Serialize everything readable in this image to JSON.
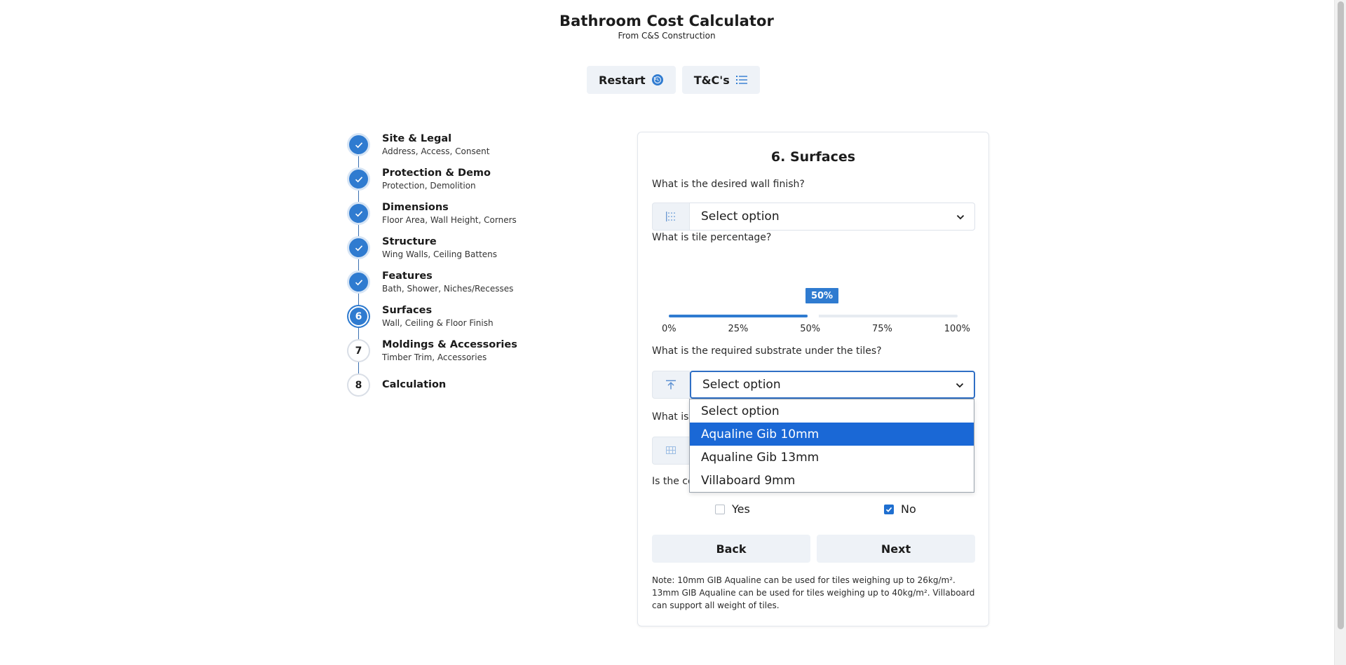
{
  "header": {
    "title": "Bathroom Cost Calculator",
    "subtitle": "From C&S Construction"
  },
  "actions": {
    "restart_label": "Restart",
    "restart_icon": "restart-icon",
    "tcs_label": "T&C's",
    "tcs_icon": "list-icon"
  },
  "steps": [
    {
      "number": "1",
      "name": "Site & Legal",
      "desc": "Address, Access, Consent",
      "status": "done"
    },
    {
      "number": "2",
      "name": "Protection & Demo",
      "desc": "Protection, Demolition",
      "status": "done"
    },
    {
      "number": "3",
      "name": "Dimensions",
      "desc": "Floor Area, Wall Height, Corners",
      "status": "done"
    },
    {
      "number": "4",
      "name": "Structure",
      "desc": "Wing Walls, Ceiling Battens",
      "status": "done"
    },
    {
      "number": "5",
      "name": "Features",
      "desc": "Bath, Shower, Niches/Recesses",
      "status": "done"
    },
    {
      "number": "6",
      "name": "Surfaces",
      "desc": "Wall, Ceiling & Floor Finish",
      "status": "active"
    },
    {
      "number": "7",
      "name": "Moldings & Accessories",
      "desc": "Timber Trim, Accessories",
      "status": "todo"
    },
    {
      "number": "8",
      "name": "Calculation",
      "desc": "",
      "status": "todo"
    }
  ],
  "form": {
    "title": "6. Surfaces",
    "wall_finish": {
      "question": "What is the desired wall finish?",
      "value": "Select option"
    },
    "tile_percentage": {
      "question": "What is tile percentage?",
      "value": 50,
      "value_label": "50%",
      "ticks": [
        "0%",
        "25%",
        "50%",
        "75%",
        "100%"
      ]
    },
    "substrate": {
      "question": "What is the required substrate under the tiles?",
      "value": "Select option",
      "options": [
        "Select option",
        "Aqualine Gib 10mm",
        "Aqualine Gib 13mm",
        "Villaboard 9mm"
      ],
      "highlighted": "Aqualine Gib 10mm"
    },
    "hidden_question_prefix": "What is",
    "ceiling_question_prefix": "Is the ce",
    "yes_label": "Yes",
    "no_label": "No",
    "yes_checked": false,
    "no_checked": true,
    "back_label": "Back",
    "next_label": "Next",
    "note": "Note: 10mm GIB Aqualine can be used for tiles weighing up to 26kg/m². 13mm GIB Aqualine can be used for tiles weighing up to 40kg/m². Villaboard can support all weight of tiles."
  },
  "colors": {
    "accent": "#2f7bd0",
    "highlight": "#1a68d6",
    "button_bg": "#eef2f7"
  }
}
